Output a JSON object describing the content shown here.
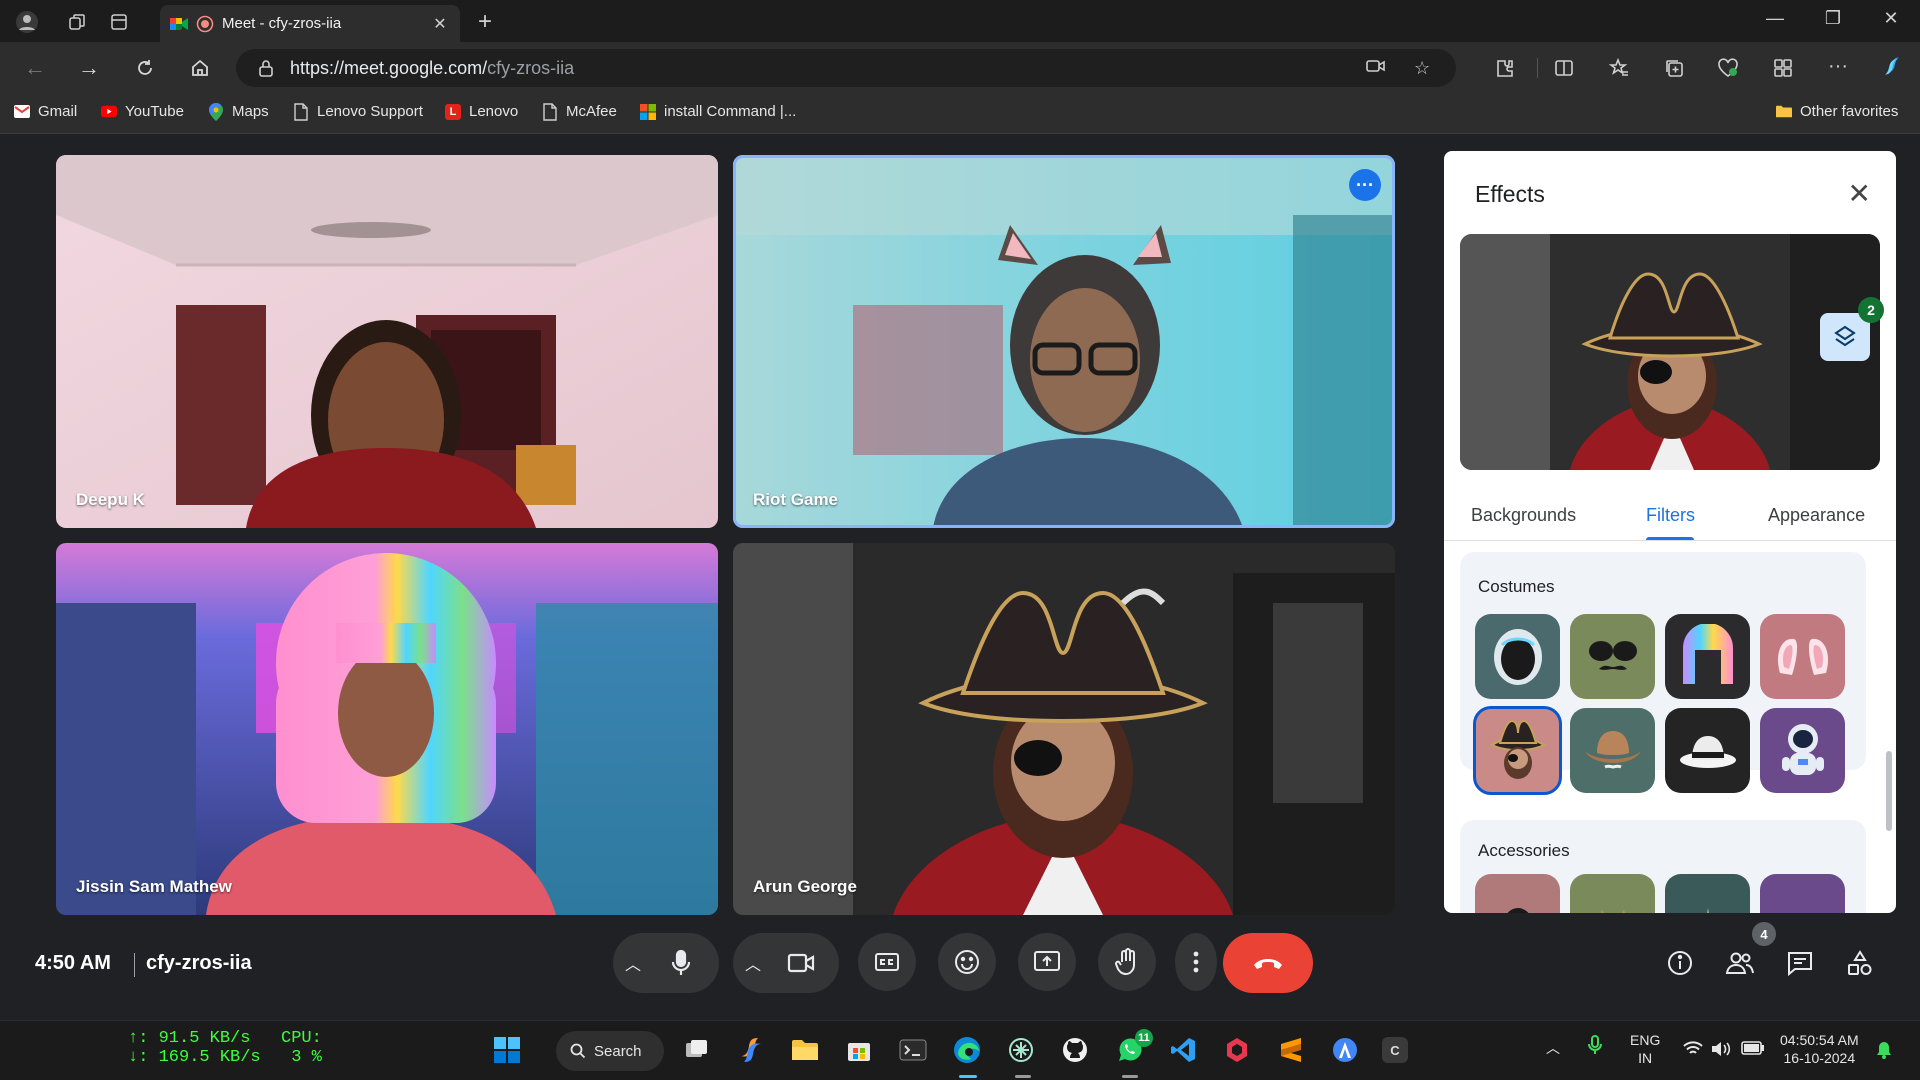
{
  "browser": {
    "tab_title": "Meet - cfy-zros-iia",
    "url_host": "https://meet.google.com/",
    "url_path": "cfy-zros-iia"
  },
  "bookmarks": [
    {
      "label": "Gmail",
      "icon": "gmail-icon",
      "color": "#ea4335"
    },
    {
      "label": "YouTube",
      "icon": "youtube-icon",
      "color": "#ff0000"
    },
    {
      "label": "Maps",
      "icon": "maps-icon",
      "color": "#34a853"
    },
    {
      "label": "Lenovo Support",
      "icon": "page-icon",
      "color": "#9aa0a6"
    },
    {
      "label": "Lenovo",
      "icon": "lenovo-icon",
      "color": "#e2231a"
    },
    {
      "label": "McAfee",
      "icon": "page-icon",
      "color": "#9aa0a6"
    },
    {
      "label": "install Command |...",
      "icon": "windows-icon",
      "color": "#00a4ef"
    }
  ],
  "bookmarks_other": "Other favorites",
  "participants": [
    {
      "name": "Deepu K"
    },
    {
      "name": "Riot Game"
    },
    {
      "name": "Jissin Sam Mathew"
    },
    {
      "name": "Arun George"
    }
  ],
  "effects": {
    "title": "Effects",
    "layers_count": "2",
    "tabs": [
      "Backgrounds",
      "Filters",
      "Appearance"
    ],
    "selected_tab": "Filters",
    "sections": [
      {
        "title": "Costumes",
        "items": [
          "astronaut-helmet",
          "sunglasses-mustache",
          "rainbow-wig",
          "bunny-ears",
          "pirate-hat",
          "cowboy-hat",
          "fedora",
          "astronaut"
        ],
        "selected": "pirate-hat"
      },
      {
        "title": "Accessories"
      }
    ]
  },
  "controls": {
    "time": "4:50 AM",
    "meeting_code": "cfy-zros-iia",
    "people_count": "4"
  },
  "taskbar": {
    "net_up": "↑: 91.5 KB/s",
    "net_down": "↓: 169.5 KB/s",
    "cpu_label": "CPU:",
    "cpu_value": "3 %",
    "search_label": "Search",
    "whatsapp_badge": "11",
    "lang": "ENG",
    "region": "IN",
    "clock_time": "04:50:54 AM",
    "clock_date": "16-10-2024"
  }
}
